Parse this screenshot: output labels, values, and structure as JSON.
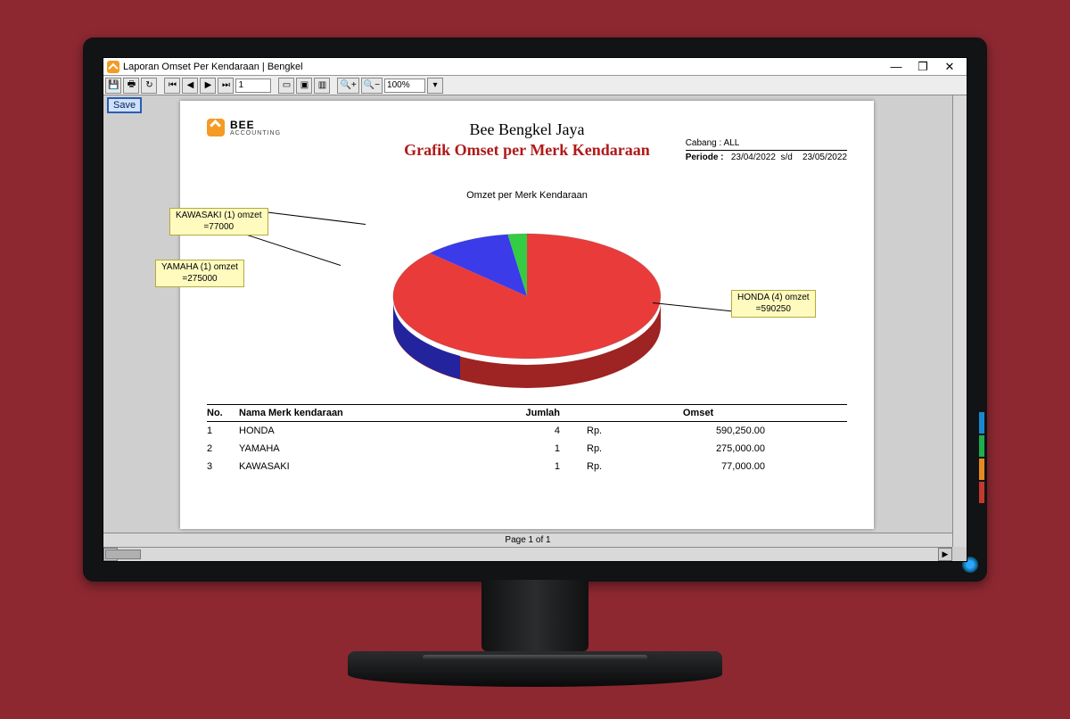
{
  "window": {
    "title": "Laporan Omset Per Kendaraan | Bengkel",
    "minimize": "—",
    "maximize": "❐",
    "close": "✕"
  },
  "toolbar": {
    "page_value": "1",
    "zoom_value": "100%",
    "save_badge": "Save"
  },
  "footer": "Page 1 of 1",
  "logo": {
    "line1": "BEE",
    "line2": "ACCOUNTING"
  },
  "report": {
    "company": "Bee Bengkel Jaya",
    "subtitle": "Grafik Omset per Merk Kendaraan",
    "cabang_label": "Cabang :",
    "cabang_value": "ALL",
    "periode_label": "Periode :",
    "periode_from": "23/04/2022",
    "periode_sep": "s/d",
    "periode_to": "23/05/2022",
    "chart_title": "Omzet per Merk Kendaraan"
  },
  "callouts": {
    "kawasaki": "KAWASAKI (1) omzet\n=77000",
    "yamaha": "YAMAHA (1) omzet\n=275000",
    "honda": "HONDA (4) omzet\n=590250"
  },
  "table": {
    "head": {
      "no": "No.",
      "name": "Nama Merk kendaraan",
      "jumlah": "Jumlah",
      "omset": "Omset"
    },
    "currency": "Rp.",
    "rows": [
      {
        "no": "1",
        "name": "HONDA",
        "jumlah": "4",
        "omset": "590,250.00"
      },
      {
        "no": "2",
        "name": "YAMAHA",
        "jumlah": "1",
        "omset": "275,000.00"
      },
      {
        "no": "3",
        "name": "KAWASAKI",
        "jumlah": "1",
        "omset": "77,000.00"
      }
    ]
  },
  "chart_data": {
    "type": "pie",
    "title": "Omzet per Merk Kendaraan",
    "series": [
      {
        "name": "HONDA",
        "count": 4,
        "value": 590250,
        "color": "#ea3b3b"
      },
      {
        "name": "YAMAHA",
        "count": 1,
        "value": 275000,
        "color": "#3b3bea"
      },
      {
        "name": "KAWASAKI",
        "count": 1,
        "value": 77000,
        "color": "#33cc44"
      }
    ]
  }
}
